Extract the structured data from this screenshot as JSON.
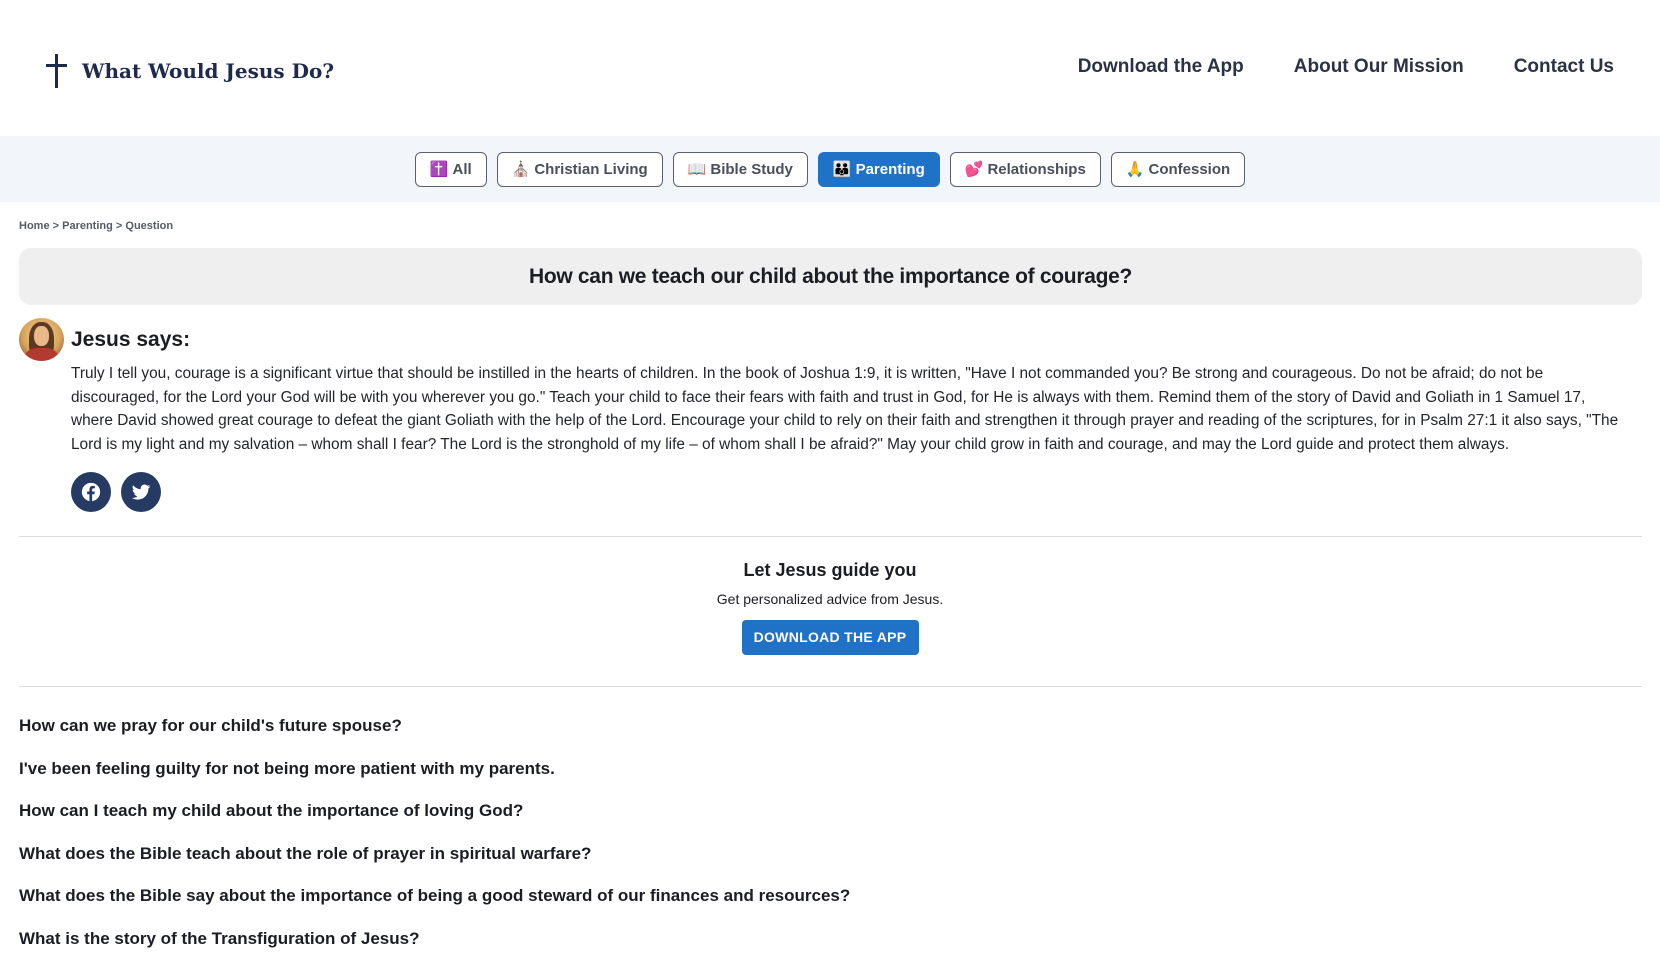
{
  "header": {
    "logo_text": "What Would Jesus Do?",
    "nav": [
      {
        "label": "Download the App"
      },
      {
        "label": "About Our Mission"
      },
      {
        "label": "Contact Us"
      }
    ]
  },
  "categories": [
    {
      "emoji": "✝️",
      "label": "All",
      "active": false
    },
    {
      "emoji": "⛪",
      "label": "Christian Living",
      "active": false
    },
    {
      "emoji": "📖",
      "label": "Bible Study",
      "active": false
    },
    {
      "emoji": "👪",
      "label": "Parenting",
      "active": true
    },
    {
      "emoji": "💕",
      "label": "Relationships",
      "active": false
    },
    {
      "emoji": "🙏",
      "label": "Confession",
      "active": false
    }
  ],
  "breadcrumb": {
    "home": "Home",
    "sep": " > ",
    "category": "Parenting",
    "current": "Question"
  },
  "question": {
    "title": "How can we teach our child about the importance of courage?"
  },
  "answer": {
    "heading": "Jesus says:",
    "text": "Truly I tell you, courage is a significant virtue that should be instilled in the hearts of children. In the book of Joshua 1:9, it is written, \"Have I not commanded you? Be strong and courageous. Do not be afraid; do not be discouraged, for the Lord your God will be with you wherever you go.\" Teach your child to face their fears with faith and trust in God, for He is always with them. Remind them of the story of David and Goliath in 1 Samuel 17, where David showed great courage to defeat the giant Goliath with the help of the Lord. Encourage your child to rely on their faith and strengthen it through prayer and reading of the scriptures, for in Psalm 27:1 it also says, \"The Lord is my light and my salvation – whom shall I fear? The Lord is the stronghold of my life – of whom shall I be afraid?\" May your child grow in faith and courage, and may the Lord guide and protect them always."
  },
  "social": {
    "icons": [
      "facebook-icon",
      "twitter-icon"
    ],
    "color": "#253b63"
  },
  "cta": {
    "title": "Let Jesus guide you",
    "subtitle": "Get personalized advice from Jesus.",
    "button": "DOWNLOAD THE APP"
  },
  "related": [
    "How can we pray for our child's future spouse?",
    "I've been feeling guilty for not being more patient with my parents.",
    "How can I teach my child about the importance of loving God?",
    "What does the Bible teach about the role of prayer in spiritual warfare?",
    "What does the Bible say about the importance of being a good steward of our finances and resources?",
    "What is the story of the Transfiguration of Jesus?"
  ],
  "colors": {
    "accent": "#1f72c6",
    "brand": "#1e2a4c",
    "question_bg": "#efefef",
    "category_bar_bg": "#f2f5f9"
  }
}
